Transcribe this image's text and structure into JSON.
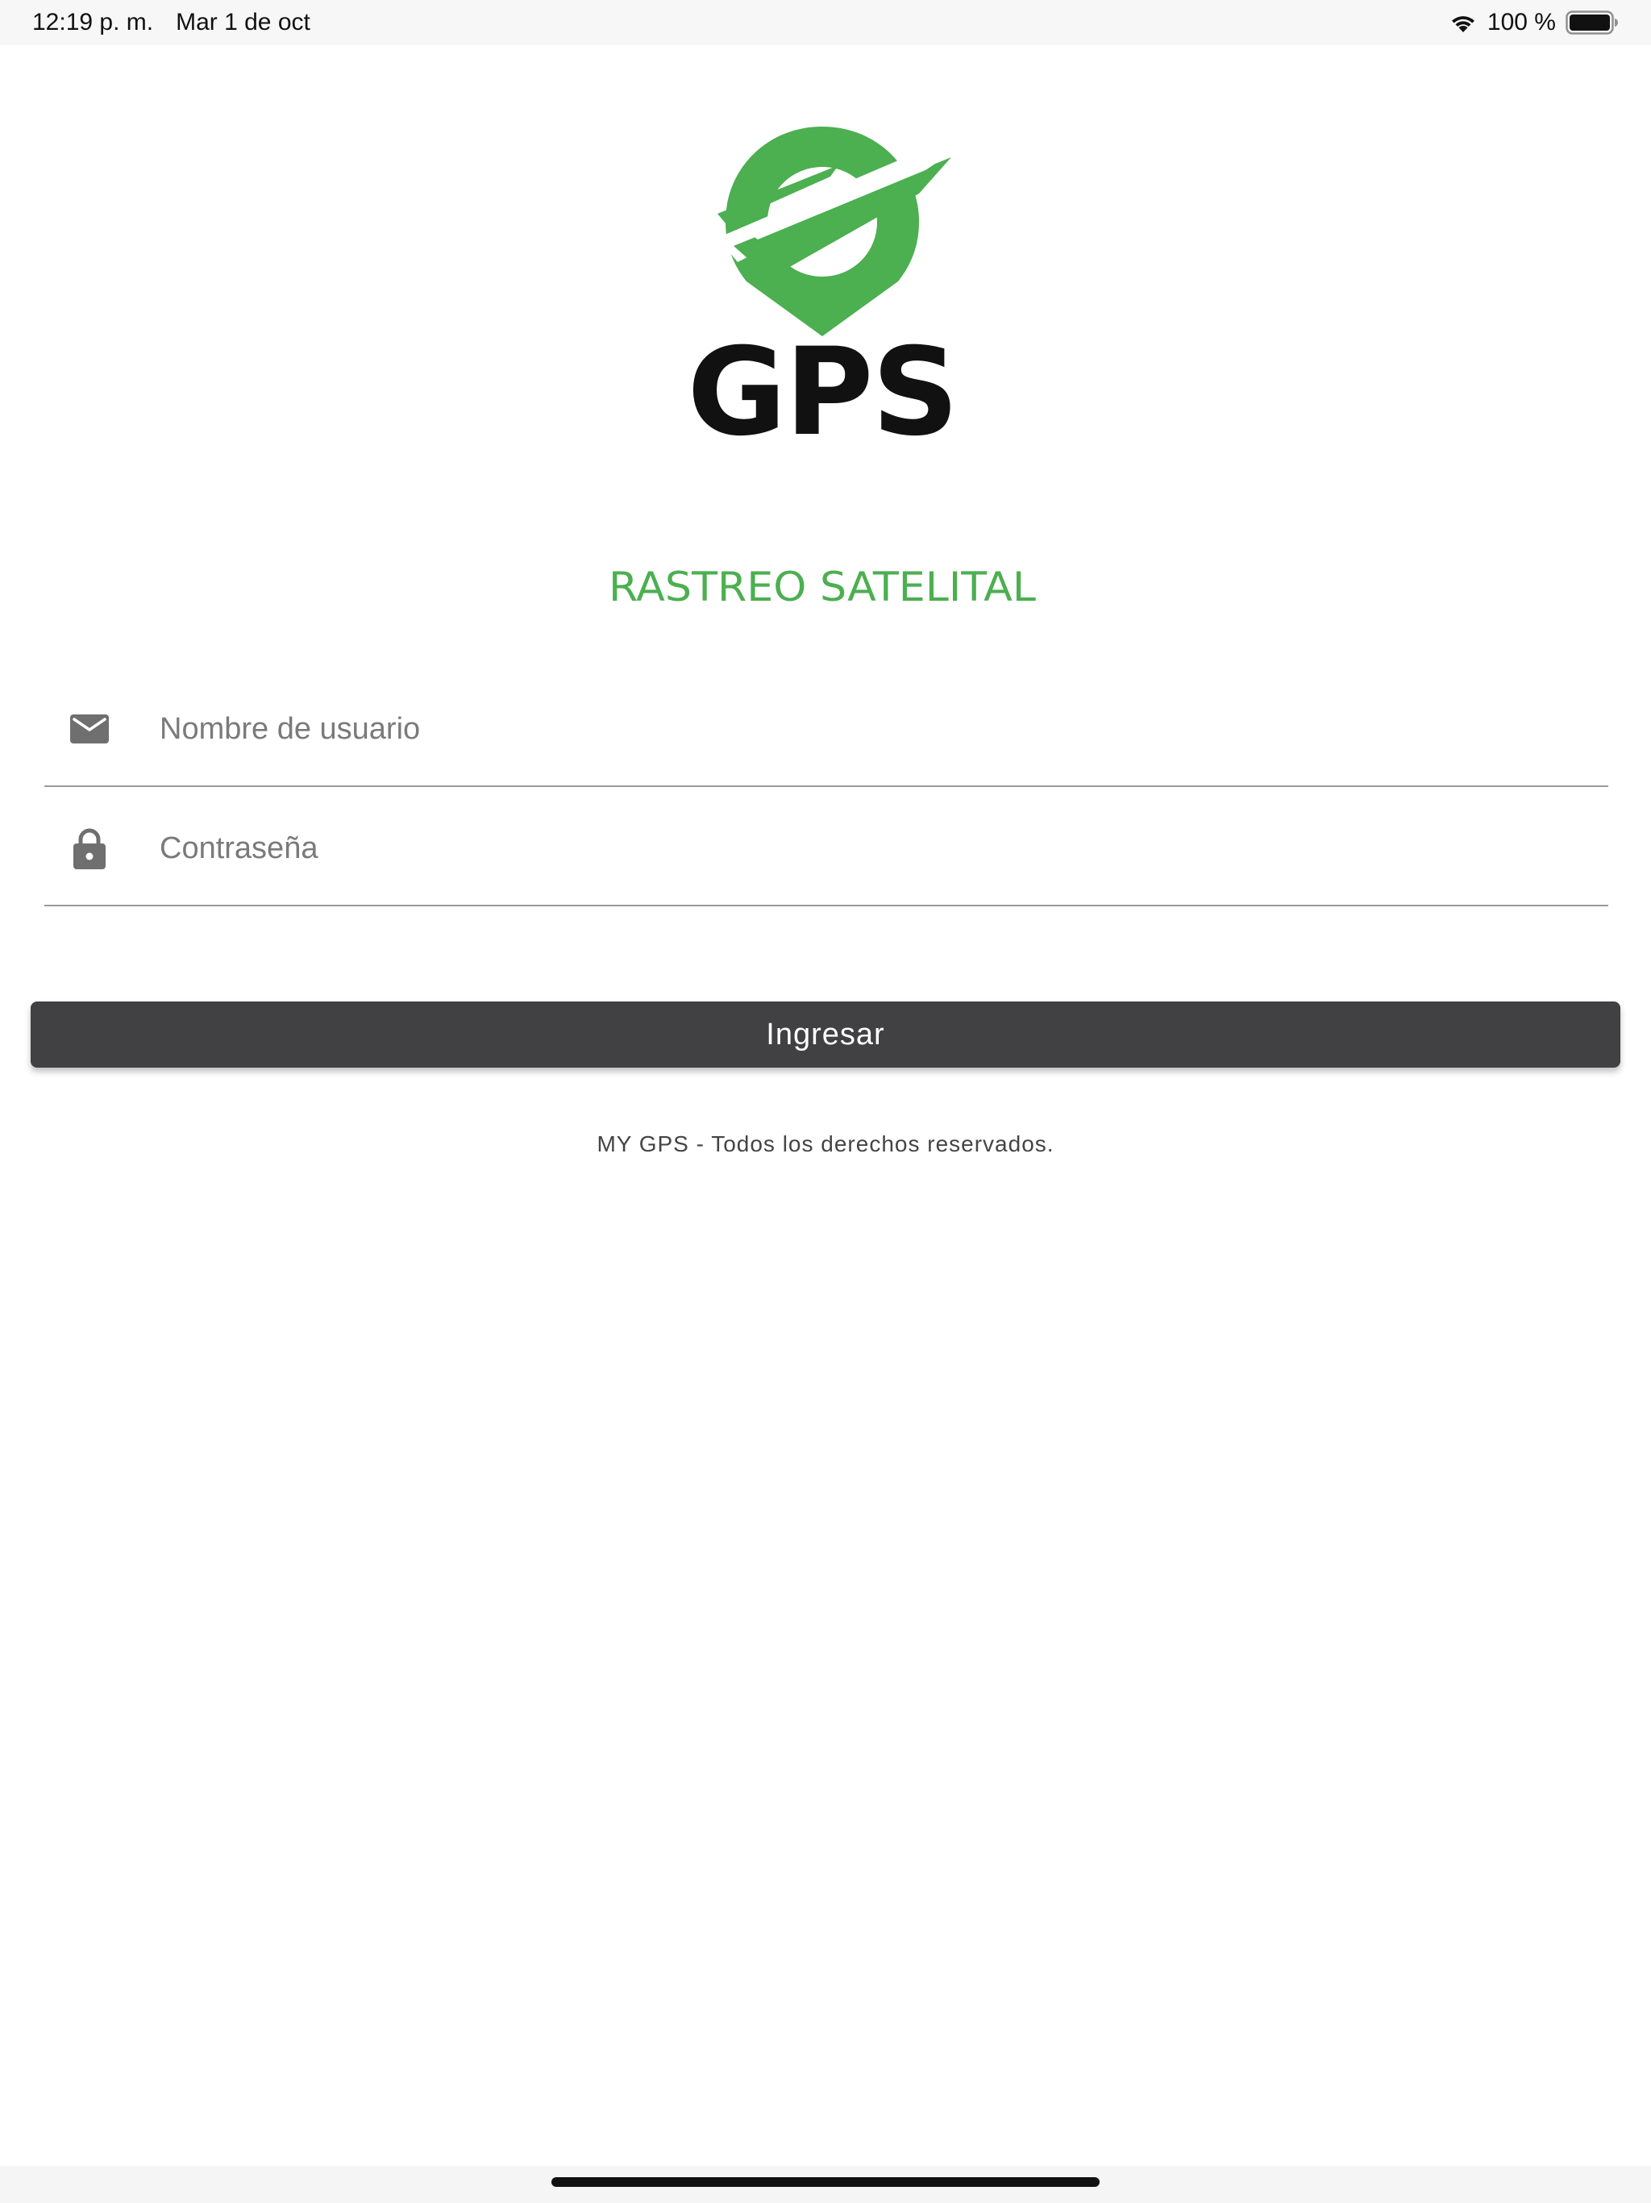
{
  "status_bar": {
    "time": "12:19 p. m.",
    "date": "Mar 1 de oct",
    "battery": "100 %"
  },
  "logo": {
    "title": "GPS",
    "subtitle": "RASTREO SATELITAL",
    "colors": {
      "green": "#4caf50",
      "dark": "#111111"
    }
  },
  "form": {
    "username": {
      "placeholder": "Nombre de usuario",
      "value": "",
      "icon": "envelope-icon"
    },
    "password": {
      "placeholder": "Contraseña",
      "value": "",
      "icon": "lock-icon"
    },
    "submit_label": "Ingresar"
  },
  "footer": {
    "copyright": "MY GPS - Todos los derechos reservados."
  },
  "colors": {
    "button_bg": "#414042",
    "field_icon": "#6f6f6f",
    "divider": "#9a9a9a"
  }
}
